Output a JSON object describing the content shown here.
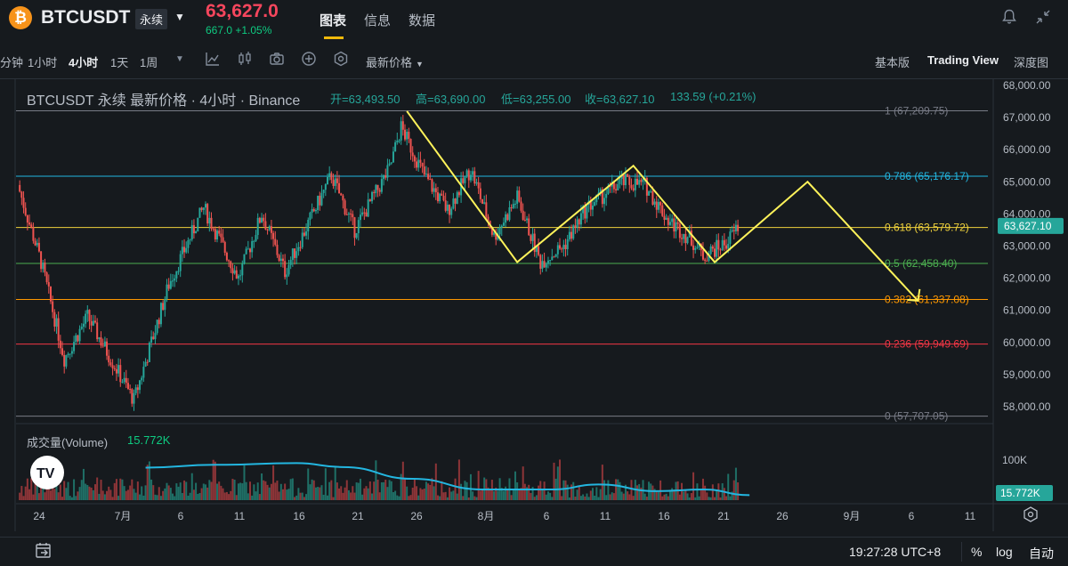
{
  "header": {
    "coin_glyph": "₿",
    "symbol": "BTCUSDT",
    "contract_type": "永续",
    "last_price": "63,627.0",
    "change": "667.0 +1.05%",
    "tabs": [
      "图表",
      "信息",
      "数据"
    ]
  },
  "toolbar": {
    "intervals": [
      "分钟",
      "1小时",
      "4小时",
      "1天",
      "1周"
    ],
    "active_interval": "4小时",
    "price_type": "最新价格",
    "views": [
      "基本版",
      "Trading View",
      "深度图"
    ],
    "active_view": "Trading View"
  },
  "legend": {
    "title": "BTCUSDT 永续 最新价格 · 4小时 · Binance",
    "open": "开=63,493.50",
    "high": "高=63,690.00",
    "low": "低=63,255.00",
    "close": "收=63,627.10",
    "change": "133.59 (+0.21%)"
  },
  "volume": {
    "label": "成交量(Volume)",
    "value": "15.772K",
    "axis_label": "100K",
    "badge": "15.772K"
  },
  "colors": {
    "up": "#26a69a",
    "down": "#ef5350",
    "accent": "#f0b90b",
    "drawing": "#fff35a",
    "ma": "#23b6e0"
  },
  "chart_data": {
    "type": "candlestick",
    "price_axis": {
      "ticks": [
        "68,000.00",
        "67,000.00",
        "66,000.00",
        "65,000.00",
        "64,000.00",
        "63,000.00",
        "62,000.00",
        "61,000.00",
        "60,000.00",
        "59,000.00",
        "58,000.00"
      ],
      "ylim": [
        57500,
        68300
      ],
      "current_price_badge": "63,627.10"
    },
    "time_axis": {
      "ticks": [
        "24",
        "7月",
        "6",
        "11",
        "16",
        "21",
        "26",
        "8月",
        "6",
        "11",
        "16",
        "21",
        "26",
        "9月",
        "6",
        "11"
      ]
    },
    "fib_levels": [
      {
        "label": "1 (67,209.75)",
        "price": 67209.75,
        "color": "#787b86"
      },
      {
        "label": "0.786 (65,176.17)",
        "price": 65176.17,
        "color": "#23b6e0"
      },
      {
        "label": "0.618 (63,579.72)",
        "price": 63579.72,
        "color": "#f0d23c"
      },
      {
        "label": "0.5 (62,458.40)",
        "price": 62458.4,
        "color": "#4caf50"
      },
      {
        "label": "0.382 (61,337.08)",
        "price": 61337.08,
        "color": "#ff9800"
      },
      {
        "label": "0.236 (59,949.69)",
        "price": 59949.69,
        "color": "#f23645"
      },
      {
        "label": "0 (57,707.05)",
        "price": 57707.05,
        "color": "#787b86"
      }
    ],
    "price_path": [
      {
        "day": 0,
        "price": 64900
      },
      {
        "day": 2,
        "price": 62500
      },
      {
        "day": 4,
        "price": 59500
      },
      {
        "day": 6,
        "price": 60800
      },
      {
        "day": 10,
        "price": 58200
      },
      {
        "day": 13,
        "price": 61800
      },
      {
        "day": 16,
        "price": 64200
      },
      {
        "day": 19,
        "price": 62000
      },
      {
        "day": 21,
        "price": 64000
      },
      {
        "day": 23,
        "price": 62200
      },
      {
        "day": 27,
        "price": 65200
      },
      {
        "day": 29,
        "price": 63500
      },
      {
        "day": 32,
        "price": 65400
      },
      {
        "day": 33,
        "price": 66700
      },
      {
        "day": 35,
        "price": 65200
      },
      {
        "day": 37,
        "price": 64100
      },
      {
        "day": 39,
        "price": 65400
      },
      {
        "day": 41,
        "price": 63300
      },
      {
        "day": 43,
        "price": 64500
      },
      {
        "day": 45,
        "price": 62500
      },
      {
        "day": 47,
        "price": 63000
      },
      {
        "day": 49,
        "price": 64200
      },
      {
        "day": 52,
        "price": 65000
      },
      {
        "day": 54,
        "price": 64900
      },
      {
        "day": 56,
        "price": 63800
      },
      {
        "day": 58,
        "price": 63200
      },
      {
        "day": 59,
        "price": 62700
      },
      {
        "day": 61,
        "price": 63100
      },
      {
        "day": 62,
        "price": 63600
      }
    ],
    "projection_zigzag": [
      {
        "day": 33.5,
        "price": 67200
      },
      {
        "day": 43,
        "price": 62500
      },
      {
        "day": 53,
        "price": 65500
      },
      {
        "day": 60,
        "price": 62500
      },
      {
        "day": 68,
        "price": 65000
      },
      {
        "day": 77.5,
        "price": 61300
      }
    ],
    "volume_ma": [
      {
        "day": 11,
        "vol": 58000
      },
      {
        "day": 17,
        "vol": 63000
      },
      {
        "day": 24,
        "vol": 66000
      },
      {
        "day": 28,
        "vol": 59000
      },
      {
        "day": 34,
        "vol": 38000
      },
      {
        "day": 40,
        "vol": 19000
      },
      {
        "day": 46,
        "vol": 19000
      },
      {
        "day": 50,
        "vol": 28000
      },
      {
        "day": 55,
        "vol": 16000
      },
      {
        "day": 59,
        "vol": 19000
      },
      {
        "day": 63,
        "vol": 9000
      }
    ]
  },
  "status": {
    "time": "19:27:28 UTC+8",
    "percent": "%",
    "log": "log",
    "auto": "自动"
  }
}
